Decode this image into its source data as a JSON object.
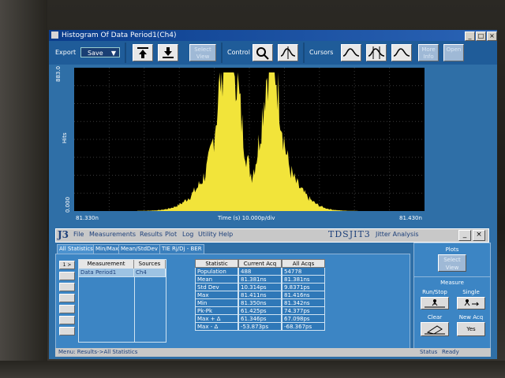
{
  "window": {
    "title": "Histogram Of Data Period1(Ch4)"
  },
  "toolbar": {
    "export_label": "Export",
    "save_label": "Save",
    "select_view_label": "Select View",
    "control_label": "Control",
    "cursors_label": "Cursors",
    "more_label": "More Info",
    "last_label": "Open"
  },
  "plot": {
    "y_axis_label": "Hits",
    "y_max_label": "883.0",
    "y_min_label": "0.000",
    "x_left_label": "81.330n",
    "x_right_label": "81.430n",
    "x_axis_label": "Time (s)   10.000p/div"
  },
  "jitter": {
    "logo": "J3",
    "menu": [
      "File",
      "Measurements",
      "Results",
      "Plot",
      "Log",
      "Utility",
      "Help"
    ],
    "title": "TDSJIT3",
    "subtitle": "Jitter Analysis"
  },
  "tabs": [
    "All Statistics",
    "Min/Max",
    "Mean/StdDev",
    "TIE Rj/Dj - BER"
  ],
  "meas_table": {
    "headers": [
      "Measurement",
      "Sources"
    ],
    "row_label": "1 >",
    "rows": [
      [
        "Data Period1",
        "Ch4"
      ]
    ]
  },
  "stats_table": {
    "headers": [
      "Statistic",
      "Current Acq",
      "All Acqs"
    ],
    "rows": [
      [
        "Population",
        "488",
        "54778"
      ],
      [
        "Mean",
        "81.381ns",
        "81.381ns"
      ],
      [
        "Std Dev",
        "10.314ps",
        "9.8371ps"
      ],
      [
        "Max",
        "81.411ns",
        "81.416ns"
      ],
      [
        "Min",
        "81.350ns",
        "81.342ns"
      ],
      [
        "Pk-Pk",
        "61.425ps",
        "74.377ps"
      ],
      [
        "Max + Δ",
        "61.346ps",
        "67.098ps"
      ],
      [
        "Max - Δ",
        "-53.873ps",
        "-68.367ps"
      ]
    ]
  },
  "right_panel": {
    "plots_label": "Plots",
    "select_view": "Select View",
    "measure_label": "Measure",
    "run_stop": "Run/Stop",
    "single": "Single",
    "clear": "Clear",
    "new_acq": "New Acq",
    "yes": "Yes"
  },
  "statusbar": {
    "left": "Menu: Results->All Statistics",
    "status_label": "Status",
    "status_value": "Ready"
  },
  "colors": {
    "histogram": "#f2e43a",
    "plot_bg": "#000000",
    "panel": "#3c85c4"
  }
}
